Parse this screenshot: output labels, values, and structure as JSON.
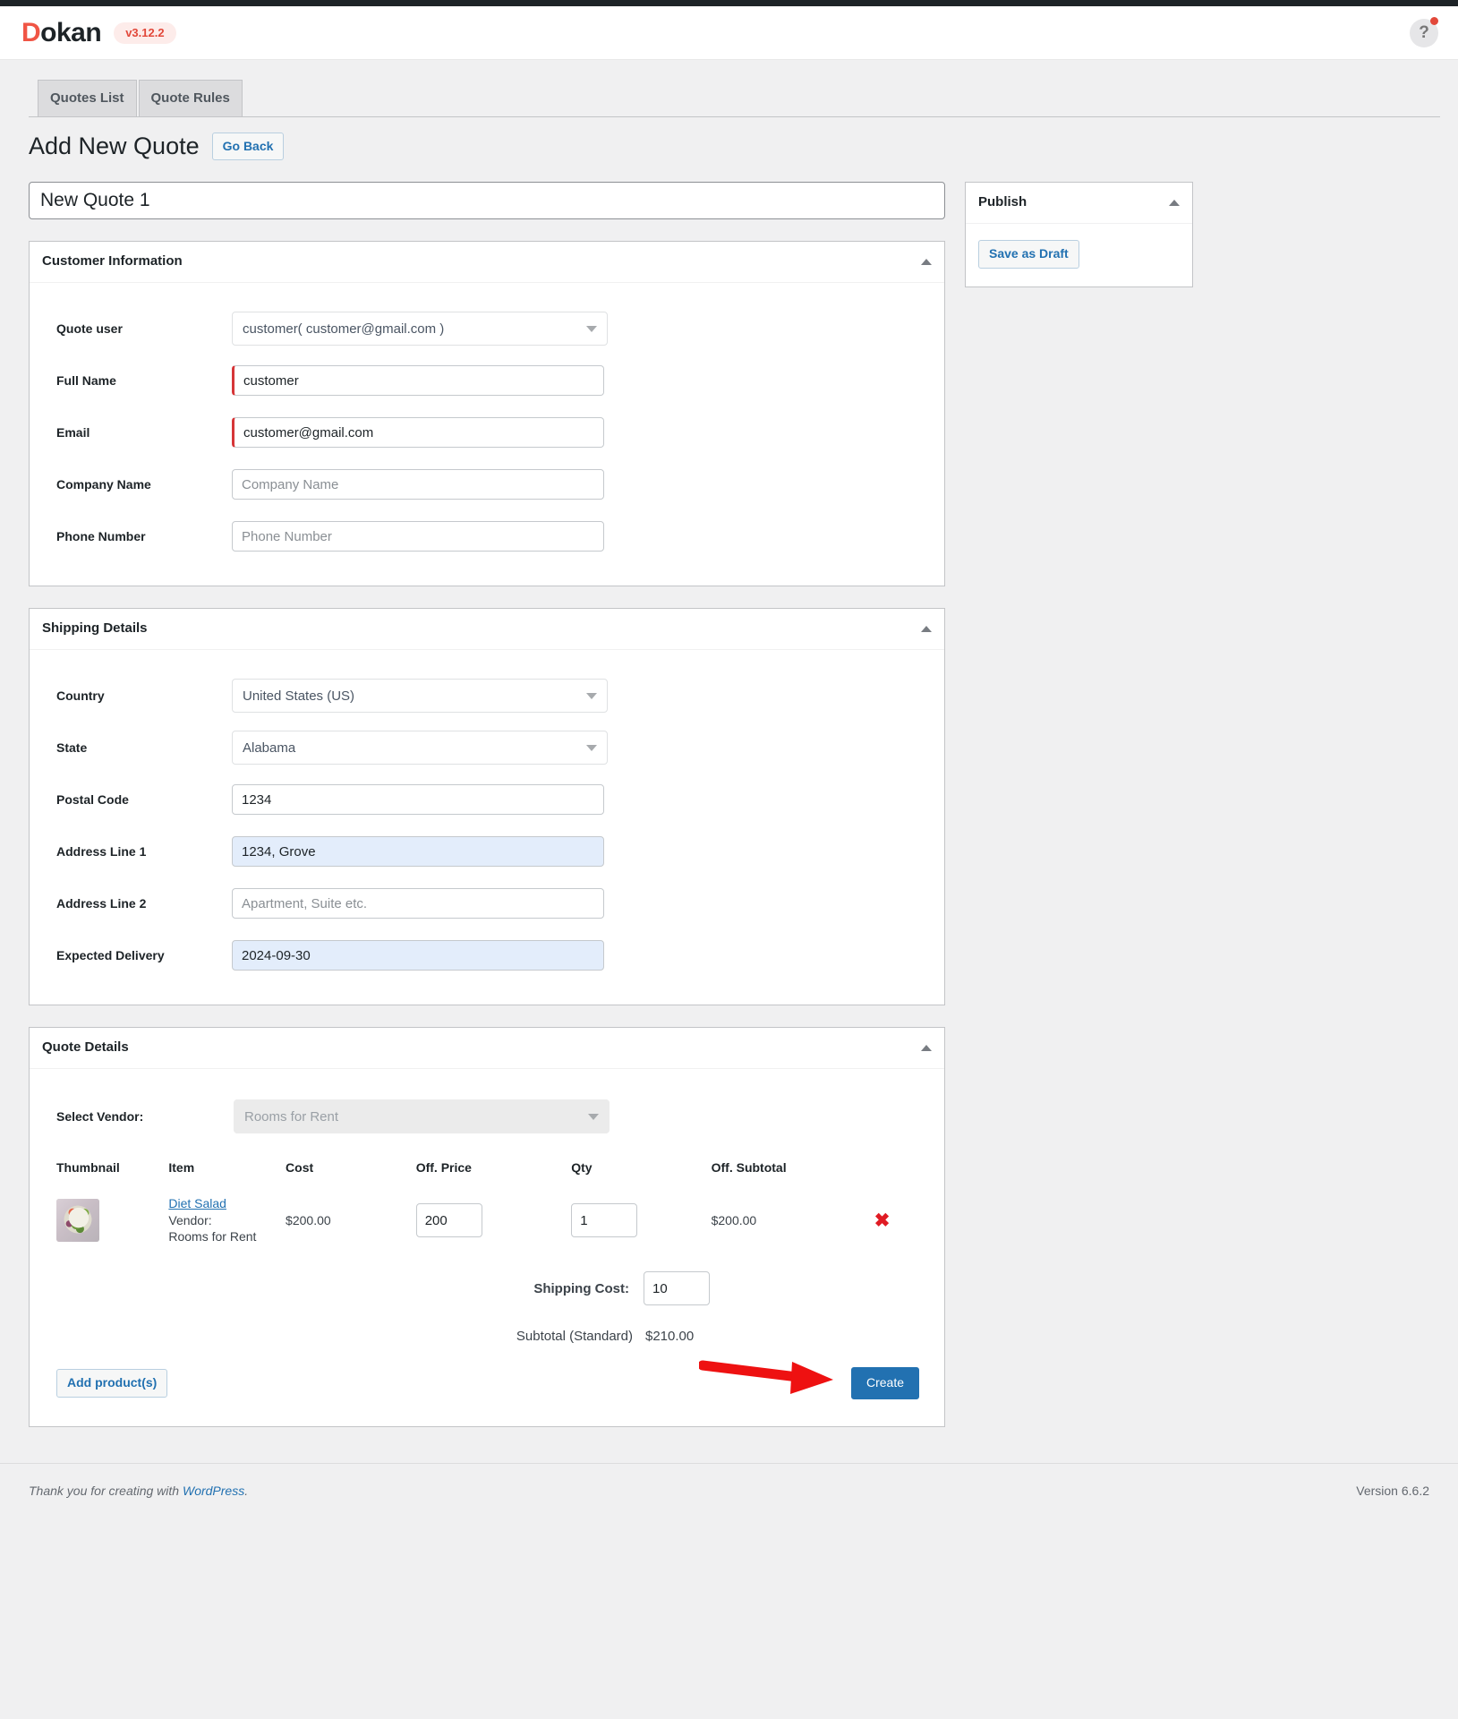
{
  "header": {
    "logo_text_first": "D",
    "logo_text_rest": "okan",
    "version_badge": "v3.12.2",
    "help_icon_label": "?"
  },
  "tabs": [
    {
      "label": "Quotes List"
    },
    {
      "label": "Quote Rules"
    }
  ],
  "page": {
    "title": "Add New Quote",
    "go_back_label": "Go Back",
    "quote_title_value": "New Quote 1"
  },
  "customer_information": {
    "panel_title": "Customer Information",
    "fields": [
      {
        "label": "Quote user",
        "value": "customer( customer@gmail.com )",
        "type": "select"
      },
      {
        "label": "Full Name",
        "value": "customer",
        "placeholder": "Full Name",
        "type": "text",
        "invalid": true
      },
      {
        "label": "Email",
        "value": "customer@gmail.com",
        "placeholder": "Email",
        "type": "text",
        "invalid": true
      },
      {
        "label": "Company Name",
        "value": "",
        "placeholder": "Company Name",
        "type": "text"
      },
      {
        "label": "Phone Number",
        "value": "",
        "placeholder": "Phone Number",
        "type": "text"
      }
    ]
  },
  "shipping_details": {
    "panel_title": "Shipping Details",
    "country_label": "Country",
    "country_value": "United States (US)",
    "state_label": "State",
    "state_value": "Alabama",
    "postal_label": "Postal Code",
    "postal_value": "1234",
    "address1_label": "Address Line 1",
    "address1_value": "1234, Grove",
    "address2_label": "Address Line 2",
    "address2_placeholder": "Apartment, Suite etc.",
    "address2_value": "",
    "delivery_label": "Expected Delivery",
    "delivery_value": "2024-09-30"
  },
  "quote_details": {
    "panel_title": "Quote Details",
    "vendor_label": "Select Vendor:",
    "vendor_value": "Rooms for Rent",
    "columns": {
      "thumbnail": "Thumbnail",
      "item": "Item",
      "cost": "Cost",
      "off_price": "Off. Price",
      "qty": "Qty",
      "off_subtotal": "Off. Subtotal"
    },
    "rows": [
      {
        "item_name": "Diet Salad",
        "vendor_prefix": "Vendor:",
        "vendor_name": "Rooms for Rent",
        "cost": "$200.00",
        "off_price": "200",
        "qty": "1",
        "off_subtotal": "$200.00",
        "remove_label": "✖"
      }
    ],
    "shipping_cost_label": "Shipping Cost:",
    "shipping_cost_value": "10",
    "subtotal_label": "Subtotal (Standard)",
    "subtotal_value": "$210.00",
    "add_products_label": "Add product(s)",
    "create_label": "Create"
  },
  "publish": {
    "panel_title": "Publish",
    "save_draft_label": "Save as Draft"
  },
  "footer": {
    "thanks_prefix": "Thank you for creating with ",
    "wordpress_link": "WordPress",
    "thanks_suffix": ".",
    "version": "Version 6.6.2"
  },
  "colors": {
    "accent_blue": "#2271b1",
    "brand_red": "#f05545",
    "invalid_red": "#d63638",
    "annotation_red": "#ee1111",
    "autofill_blue": "#e3edfb"
  }
}
